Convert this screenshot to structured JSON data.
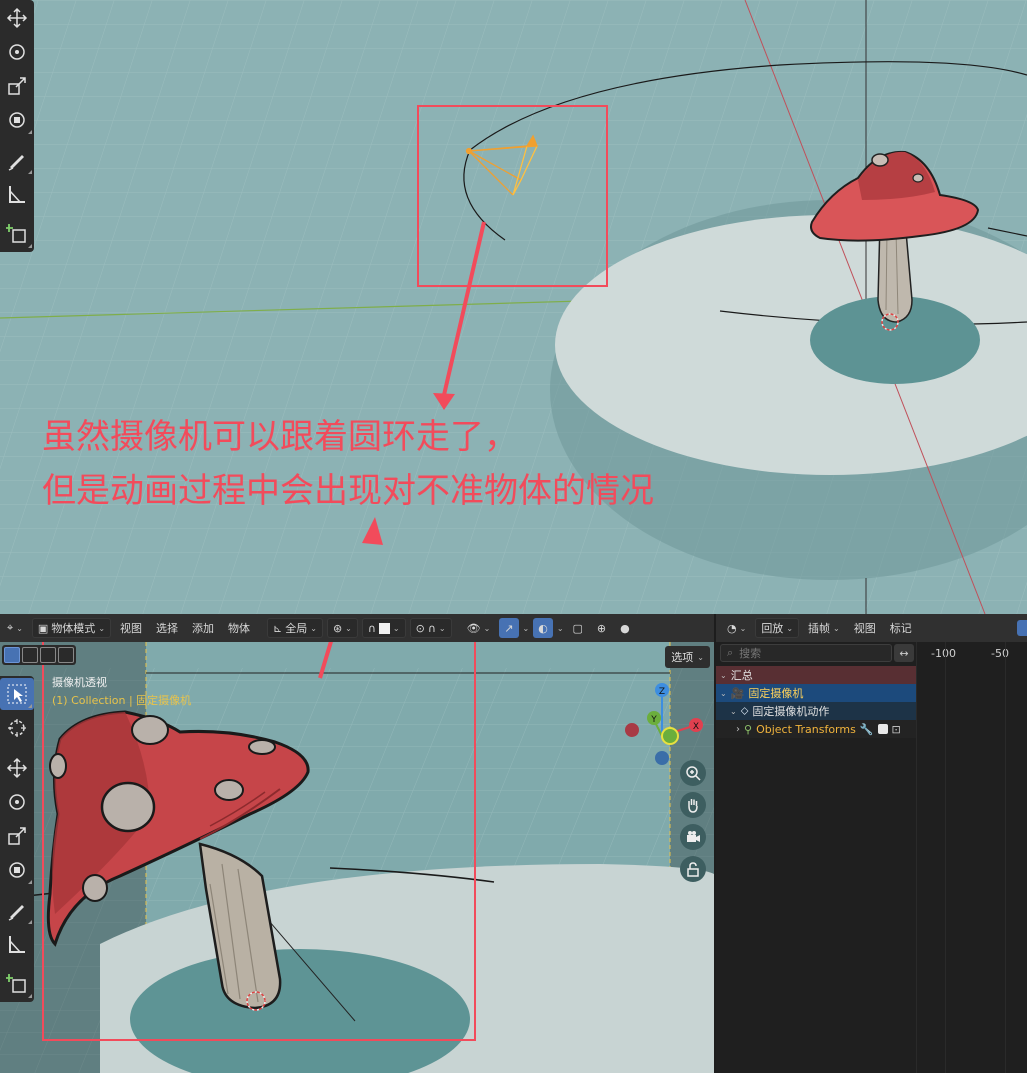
{
  "annotation": {
    "line1": "虽然摄像机可以跟着圆环走了，",
    "line2": "但是动画过程中会出现对不准物体的情况"
  },
  "viewport_header": {
    "mode": "物体模式",
    "menu_view": "视图",
    "menu_select": "选择",
    "menu_add": "添加",
    "menu_object": "物体",
    "orientation": "全局",
    "options": "选项"
  },
  "viewport_info": {
    "title": "摄像机透视",
    "collection": "(1) Collection | 固定摄像机"
  },
  "gizmo": {
    "x": "X",
    "y": "Y",
    "z": "Z"
  },
  "action_editor": {
    "menu_playback": "回放",
    "menu_keying": "插帧",
    "menu_view": "视图",
    "menu_marker": "标记",
    "search_placeholder": "搜索",
    "frame_marks": [
      "-100",
      "-50"
    ],
    "rows": {
      "summary": "汇总",
      "object": "固定摄像机",
      "action": "固定摄像机动作",
      "channel": "Object Transforms"
    }
  },
  "colors": {
    "annotation": "#f24b5b",
    "viewport_bg": "#8ab0b2",
    "floor": "#c9d6d5",
    "mushroom_cap": "#c9484b",
    "axis_x": "#e0404f",
    "axis_y": "#6bae3c",
    "axis_z": "#3d8ee0",
    "accent_blue": "#4772b3"
  }
}
